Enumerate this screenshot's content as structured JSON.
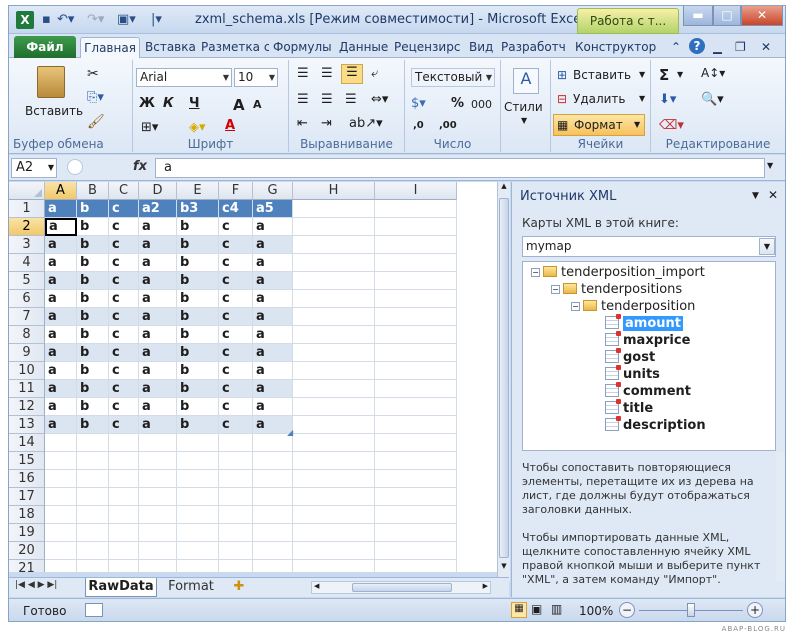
{
  "window": {
    "title": "zxml_schema.xls  [Режим совместимости] - Microsoft Excel",
    "context_tab": "Работа с т...",
    "app_icon": "X"
  },
  "ribbon_tabs": [
    "Файл",
    "Главная",
    "Вставка",
    "Разметка с",
    "Формулы",
    "Данные",
    "Рецензирс",
    "Вид",
    "Разработч",
    "Конструктор"
  ],
  "ribbon": {
    "clipboard": {
      "label": "Буфер обмена",
      "paste": "Вставить"
    },
    "font": {
      "label": "Шрифт",
      "name": "Arial",
      "size": "10",
      "bold": "Ж",
      "italic": "К",
      "underline": "Ч",
      "grow": "A",
      "shrink": "A",
      "fontcolor": "A"
    },
    "alignment": {
      "label": "Выравнивание"
    },
    "number": {
      "label": "Число",
      "format": "Текстовый",
      "percent": "%",
      "thousands": "000",
      "inc": ",0",
      "dec": ",00"
    },
    "styles": {
      "label": "Стили"
    },
    "cells": {
      "label": "Ячейки",
      "insert": "Вставить",
      "delete": "Удалить",
      "format": "Формат"
    },
    "editing": {
      "label": "Редактирование",
      "sum": "Σ"
    }
  },
  "formula_bar": {
    "cell_ref": "A2",
    "fx": "fx",
    "value": "a"
  },
  "sheet": {
    "columns": [
      "A",
      "B",
      "C",
      "D",
      "E",
      "F",
      "G",
      "H",
      "I"
    ],
    "header_row": [
      "a",
      "b",
      "c",
      "a2",
      "b3",
      "c4",
      "a5"
    ],
    "data_row": [
      "a",
      "b",
      "c",
      "a",
      "b",
      "c",
      "a"
    ],
    "row_numbers": [
      "1",
      "2",
      "3",
      "4",
      "5",
      "6",
      "7",
      "8",
      "9",
      "10",
      "11",
      "12",
      "13",
      "14",
      "15",
      "16",
      "17",
      "18",
      "19",
      "20",
      "21"
    ],
    "data_row_count": 12
  },
  "sheet_tabs": [
    "RawData",
    "Format"
  ],
  "statusbar": {
    "ready": "Готово",
    "zoom": "100%"
  },
  "xml_pane": {
    "title": "Источник XML",
    "maps_label": "Карты XML в этой книге:",
    "map_selected": "mymap",
    "tree": {
      "root": "tenderposition_import",
      "level1": "tenderpositions",
      "level2": "tenderposition",
      "leaves": [
        "amount",
        "maxprice",
        "gost",
        "units",
        "comment",
        "title",
        "description"
      ]
    },
    "help1": "Чтобы сопоставить повторяющиеся элементы, перетащите их из дерева на лист, где должны будут отображаться заголовки данных.",
    "help2": "Чтобы импортировать данные XML, щелкните сопоставленную ячейку XML правой кнопкой мыши и выберите пункт \"XML\", а затем команду \"Импорт\"."
  },
  "watermark": "ABAP-BLOG.RU"
}
